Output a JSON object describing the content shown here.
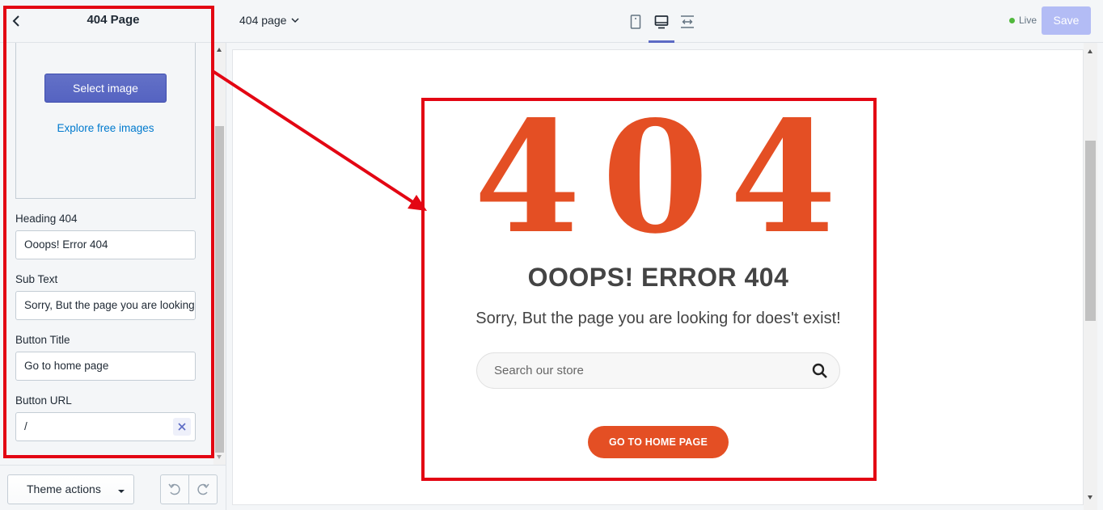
{
  "sidebar": {
    "title": "404 Page",
    "image_picker": {
      "select_label": "Select image",
      "explore_label": "Explore free images"
    },
    "fields": [
      {
        "label": "Heading 404",
        "value": "Ooops! Error 404"
      },
      {
        "label": "Sub Text",
        "value": "Sorry, But the page you are looking for does't exist!"
      },
      {
        "label": "Button Title",
        "value": "Go to home page"
      },
      {
        "label": "Button URL",
        "value": "/"
      }
    ],
    "theme_actions_label": "Theme actions"
  },
  "topbar": {
    "page_selector": "404 page",
    "status": "Live",
    "save_label": "Save"
  },
  "preview": {
    "big_code": "404",
    "heading": "OOOPS! ERROR 404",
    "subtext": "Sorry, But the page you are looking for does't exist!",
    "search_placeholder": "Search our store",
    "home_button": "GO TO HOME PAGE"
  },
  "colors": {
    "accent": "#e44f24",
    "primary_button": "#5c6ac4",
    "annotation": "#e30613",
    "live": "#50b83c"
  }
}
